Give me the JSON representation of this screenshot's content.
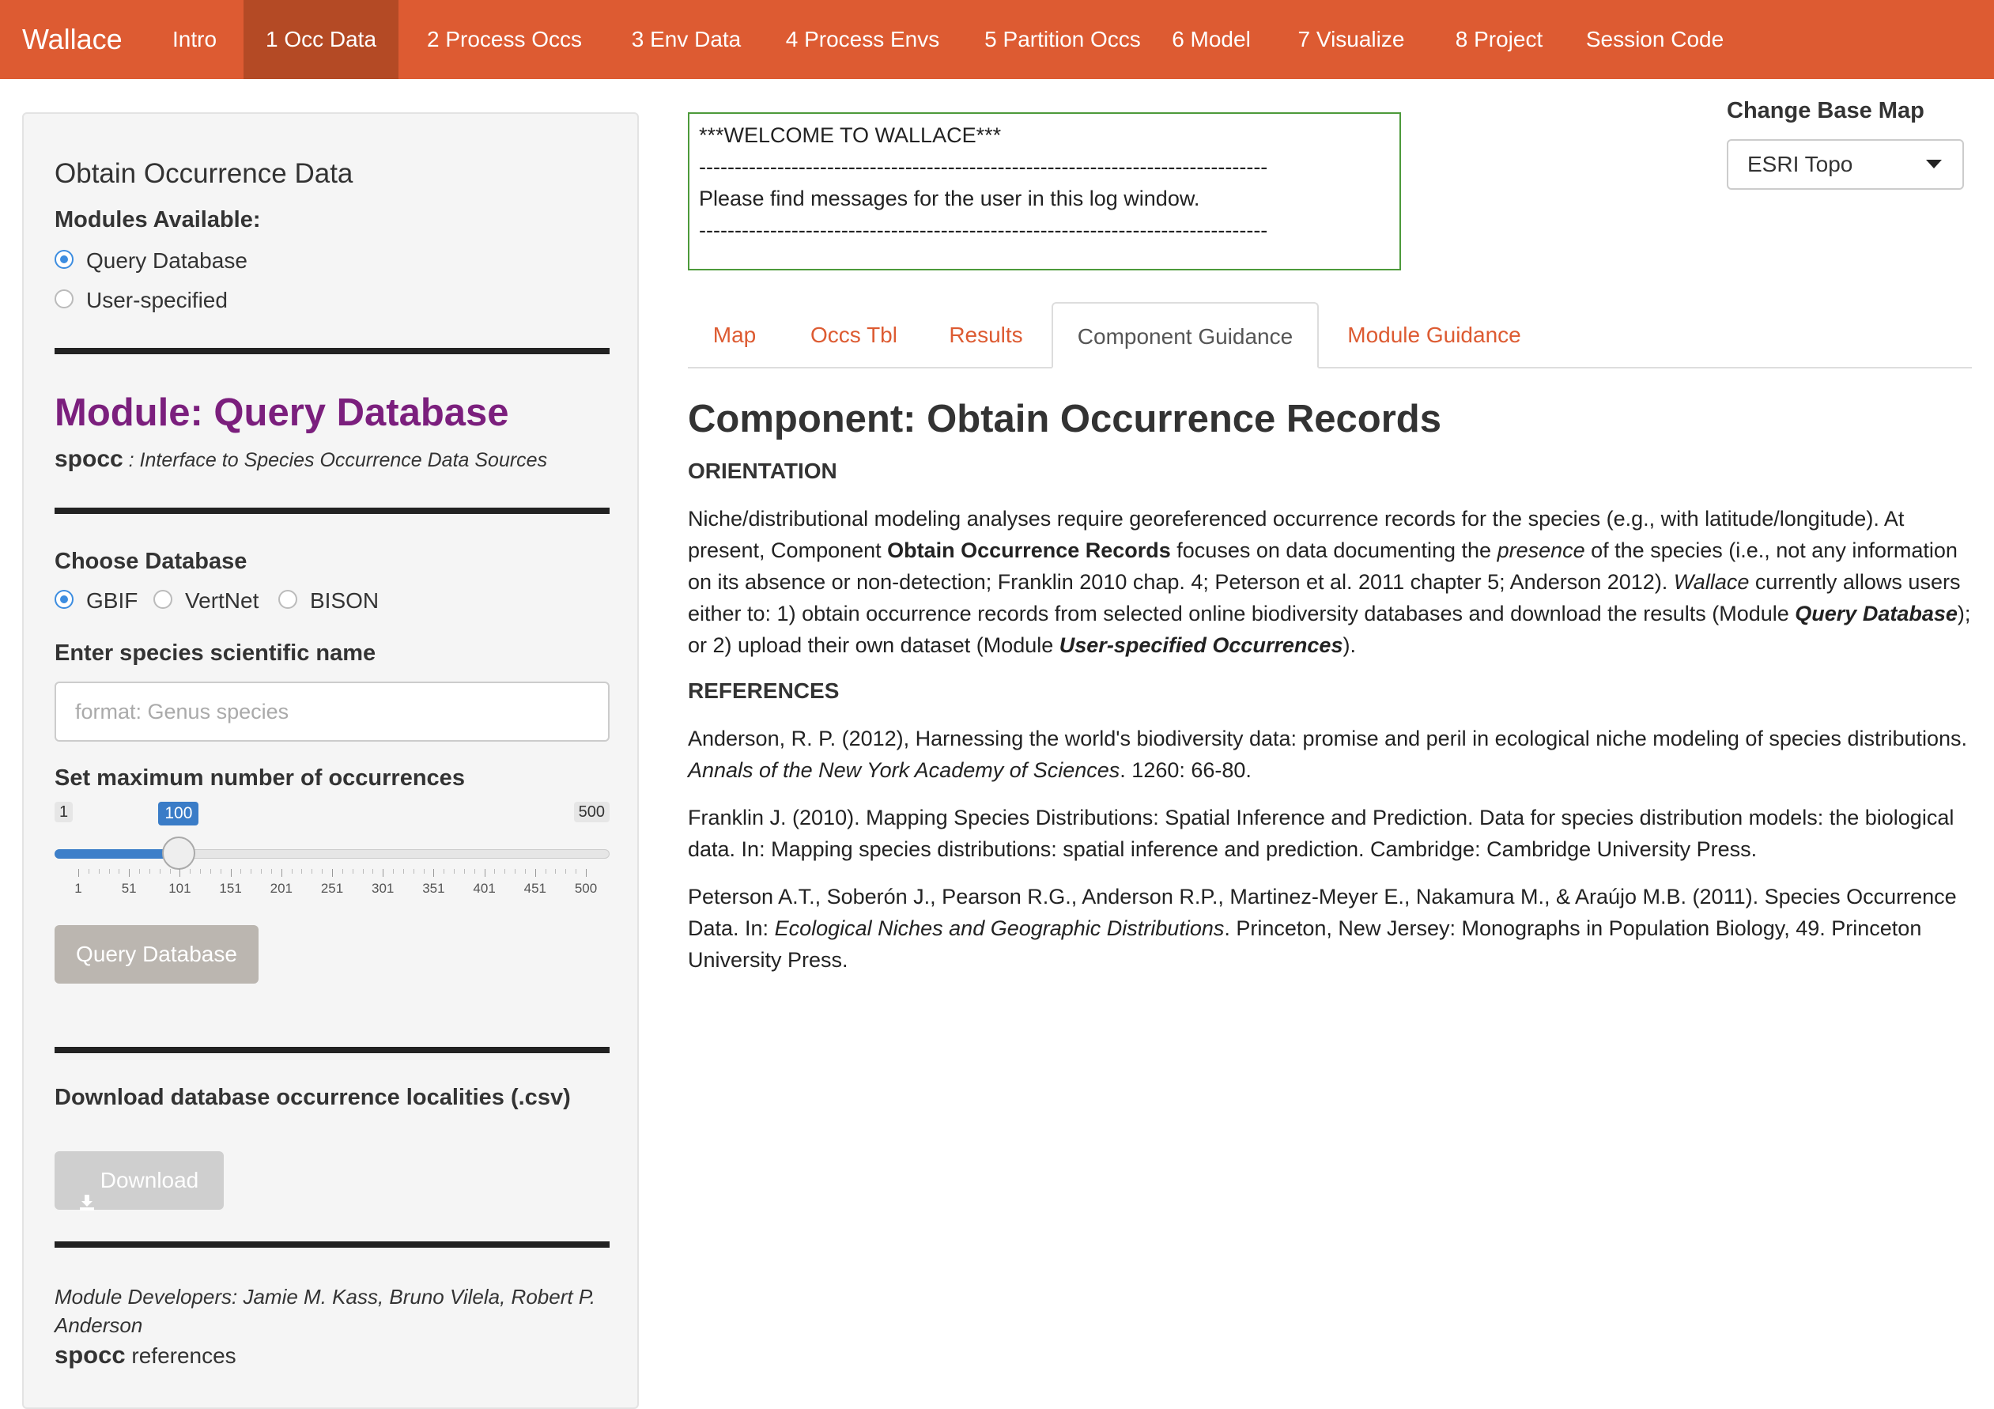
{
  "brand": "Wallace",
  "nav": [
    {
      "label": "Intro"
    },
    {
      "label": "1 Occ Data",
      "active": true
    },
    {
      "label": "2 Process Occs"
    },
    {
      "label": "3 Env Data"
    },
    {
      "label": "4 Process Envs"
    },
    {
      "label": "5 Partition Occs"
    },
    {
      "label": "6 Model"
    },
    {
      "label": "7 Visualize"
    },
    {
      "label": "8 Project"
    },
    {
      "label": "Session Code"
    }
  ],
  "sidebar": {
    "title": "Obtain Occurrence Data",
    "modules_label": "Modules Available:",
    "modules": [
      {
        "label": "Query Database",
        "selected": true
      },
      {
        "label": "User-specified",
        "selected": false
      }
    ],
    "module_title": "Module: Query Database",
    "module_pkg": "spocc",
    "module_desc": " : Interface to Species Occurrence Data Sources",
    "choose_db_label": "Choose Database",
    "databases": [
      {
        "label": "GBIF",
        "selected": true
      },
      {
        "label": "VertNet",
        "selected": false
      },
      {
        "label": "BISON",
        "selected": false
      }
    ],
    "species_label": "Enter species scientific name",
    "species_value": "",
    "species_placeholder": "format: Genus species",
    "max_label": "Set maximum number of occurrences",
    "slider": {
      "min": 1,
      "max": 500,
      "value": 100,
      "min_label": "1",
      "max_label": "500",
      "value_label": "100",
      "ticks": [
        "1",
        "51",
        "101",
        "151",
        "201",
        "251",
        "301",
        "351",
        "401",
        "451",
        "500"
      ]
    },
    "query_button": "Query Database",
    "download_label": "Download database occurrence localities (.csv)",
    "download_button": "Download",
    "download_icon": "download-icon",
    "developers": "Module Developers: Jamie M. Kass, Bruno Vilela, Robert P. Anderson",
    "ref_pkg": "spocc",
    "ref_text": " references"
  },
  "log": {
    "lines": [
      "***WELCOME TO WALLACE***",
      "--------------------------------------------------------------------------------------------------------------------",
      "Please find messages for the user in this log window.",
      "--------------------------------------------------------------------------------------------------------------------"
    ]
  },
  "basemap": {
    "label": "Change Base Map",
    "value": "ESRI Topo"
  },
  "tabs": [
    {
      "label": "Map"
    },
    {
      "label": "Occs Tbl"
    },
    {
      "label": "Results"
    },
    {
      "label": "Component Guidance",
      "active": true
    },
    {
      "label": "Module Guidance"
    }
  ],
  "content": {
    "title": "Component: Obtain Occurrence Records",
    "orientation_head": "ORIENTATION",
    "orientation": {
      "p1": "Niche/distributional modeling analyses require georeferenced occurrence records for the species (e.g., with latitude/longitude). At present, Component ",
      "b1": "Obtain Occurrence Records",
      "p2": " focuses on data documenting the ",
      "i1": "presence",
      "p3": " of the species (i.e., not any information on its absence or non-detection; Franklin 2010 chap. 4; Peterson et al. 2011 chapter 5; Anderson 2012). ",
      "i2": "Wallace",
      "p4": " currently allows users either to: 1) obtain occurrence records from selected online biodiversity databases and download the results (Module ",
      "bi1": "Query Database",
      "p5": "); or 2) upload their own dataset (Module ",
      "bi2": "User-specified Occurrences",
      "p6": ")."
    },
    "references_head": "REFERENCES",
    "refs": [
      {
        "a": "Anderson, R. P. (2012), Harnessing the world's biodiversity data: promise and peril in ecological niche modeling of species distributions. ",
        "i": "Annals of the New York Academy of Sciences",
        "b": ". 1260: 66-80."
      },
      {
        "a": "Franklin J. (2010). Mapping Species Distributions: Spatial Inference and Prediction. Data for species distribution models: the biological data. In: Mapping species distributions: spatial inference and prediction. Cambridge: Cambridge University Press.",
        "i": "",
        "b": ""
      },
      {
        "a": "Peterson A.T., Soberón J., Pearson R.G., Anderson R.P., Martinez-Meyer E., Nakamura M., & Araújo M.B. (2011). Species Occurrence Data. In: ",
        "i": "Ecological Niches and Geographic Distributions",
        "b": ". Princeton, New Jersey: Monographs in Population Biology, 49. Princeton University Press."
      }
    ]
  },
  "colors": {
    "navbar": "#dd5b32",
    "navbar_active": "#b44a25",
    "module_title": "#7b1f7d",
    "log_border": "#4d9a3b",
    "link": "#dd5b32"
  }
}
